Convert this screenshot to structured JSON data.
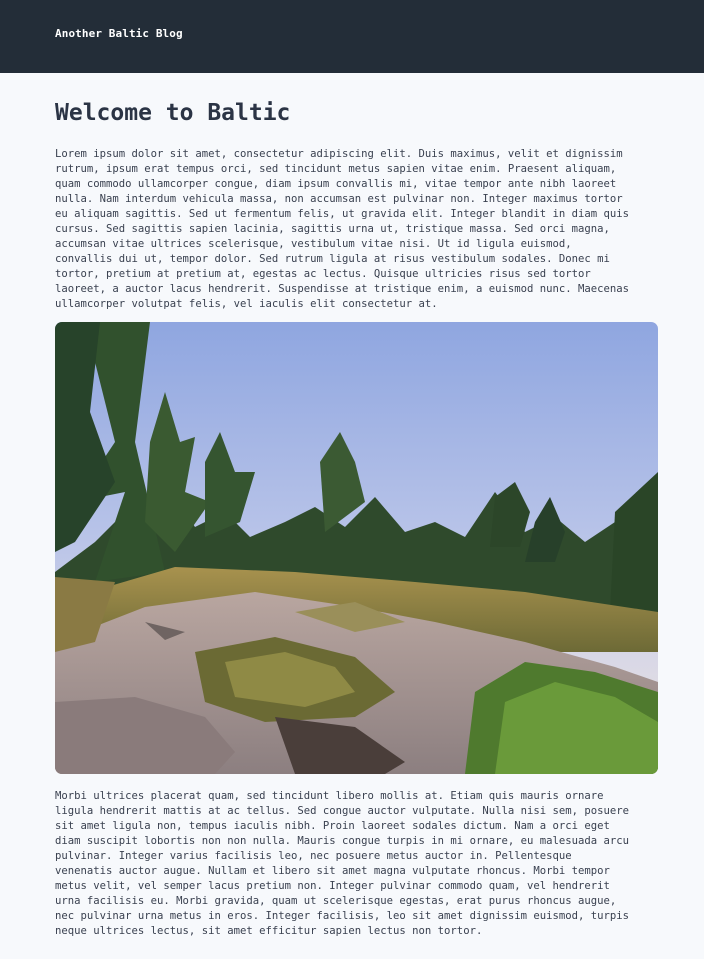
{
  "header": {
    "site_title": "Another Baltic Blog"
  },
  "post": {
    "title": "Welcome to Baltic",
    "paragraphs": [
      "Lorem ipsum dolor sit amet, consectetur adipiscing elit. Duis maximus, velit et dignissim\nrutrum, ipsum erat tempus orci, sed tincidunt metus sapien vitae enim. Praesent aliquam,\nquam commodo ullamcorper congue, diam ipsum convallis mi, vitae tempor ante nibh laoreet\nnulla. Nam interdum vehicula massa, non accumsan est pulvinar non. Integer maximus tortor\neu aliquam sagittis. Sed ut fermentum felis, ut gravida elit. Integer blandit in diam quis\ncursus. Sed sagittis sapien lacinia, sagittis urna ut, tristique massa. Sed orci magna,\naccumsan vitae ultrices scelerisque, vestibulum vitae nisi. Ut id ligula euismod,\nconvallis dui ut, tempor dolor. Sed rutrum ligula at risus vestibulum sodales. Donec mi\ntortor, pretium at pretium at, egestas ac lectus. Quisque ultricies risus sed tortor\nlaoreet, a auctor lacus hendrerit. Suspendisse at tristique enim, a euismod nunc. Maecenas\nullamcorper volutpat felis, vel iaculis elit consectetur at.",
      "Morbi ultrices placerat quam, sed tincidunt libero mollis at. Etiam quis mauris ornare\nligula hendrerit mattis at ac tellus. Sed congue auctor vulputate. Nulla nisi sem, posuere\nsit amet ligula non, tempus iaculis nibh. Proin laoreet sodales dictum. Nam a orci eget\ndiam suscipit lobortis non non nulla. Mauris congue turpis in mi ornare, eu malesuada arcu\npulvinar. Integer varius facilisis leo, nec posuere metus auctor in. Pellentesque\nvenenatis auctor augue. Nullam et libero sit amet magna vulputate rhoncus. Morbi tempor\nmetus velit, vel semper lacus pretium non. Integer pulvinar commodo quam, vel hendrerit\nurna facilisis eu. Morbi gravida, quam ut scelerisque egestas, erat purus rhoncus augue,\nnec pulvinar urna metus in eros. Integer facilisis, leo sit amet dignissim euismod, turpis\nneque ultrices lectus, sit amet efficitur sapien lectus non tortor."
    ]
  },
  "colors": {
    "header_bg": "#232d38",
    "page_bg": "#f7f9fc",
    "title_text": "#2b3445",
    "body_text": "#3a4150"
  }
}
